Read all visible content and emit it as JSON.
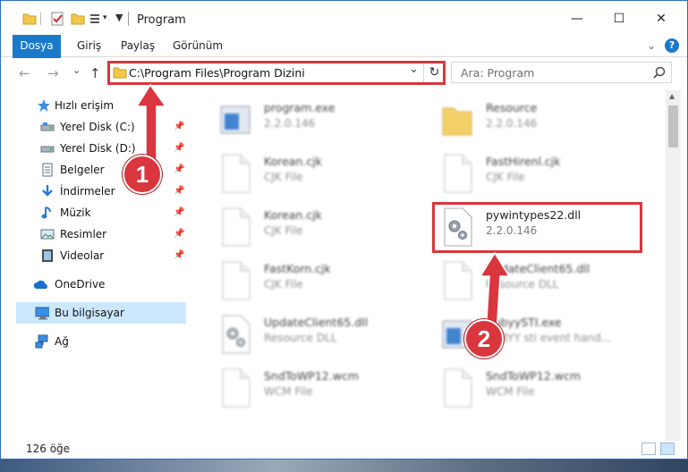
{
  "window": {
    "title": "Program",
    "controls": {
      "minimize": "—",
      "maximize": "☐",
      "close": "✕"
    }
  },
  "ribbon": {
    "tabs": [
      "Dosya",
      "Giriş",
      "Paylaş",
      "Görünüm"
    ],
    "expand": "⌄",
    "help": "?"
  },
  "nav": {
    "back": "←",
    "forward": "→",
    "recent": "⌄",
    "up": "↑",
    "address": "C:\\Program Files\\Program Dizini",
    "address_dropdown": "⌄",
    "refresh": "↻",
    "search_placeholder": "Ara: Program"
  },
  "sidebar": {
    "items": [
      {
        "label": "Hızlı erişim",
        "icon": "star-icon",
        "pinned": false
      },
      {
        "label": "Yerel Disk (C:)",
        "icon": "drive-icon",
        "pinned": true
      },
      {
        "label": "Yerel Disk (D:)",
        "icon": "drive-icon",
        "pinned": true
      },
      {
        "label": "Belgeler",
        "icon": "documents-icon",
        "pinned": true
      },
      {
        "label": "İndirmeler",
        "icon": "download-icon",
        "pinned": true
      },
      {
        "label": "Müzik",
        "icon": "music-icon",
        "pinned": true
      },
      {
        "label": "Resimler",
        "icon": "pictures-icon",
        "pinned": true
      },
      {
        "label": "Videolar",
        "icon": "videos-icon",
        "pinned": true
      },
      {
        "label": "OneDrive",
        "icon": "cloud-icon",
        "pinned": false
      },
      {
        "label": "Bu bilgisayar",
        "icon": "computer-icon",
        "pinned": false,
        "selected": true
      },
      {
        "label": "Ağ",
        "icon": "network-icon",
        "pinned": false
      }
    ],
    "pin_glyph": "📌"
  },
  "files": [
    {
      "name": "program.exe",
      "meta": "2.2.0.146",
      "icon": "exe-icon",
      "blurred": true
    },
    {
      "name": "Resource",
      "meta": "2.2.0.146",
      "icon": "folder-icon",
      "blurred": true
    },
    {
      "name": "Korean.cjk",
      "meta": "CJK File",
      "icon": "file-icon",
      "blurred": true
    },
    {
      "name": "FastHirenl.cjk",
      "meta": "CJK File",
      "icon": "file-icon",
      "blurred": true
    },
    {
      "name": "Korean.cjk",
      "meta": "CJK File",
      "icon": "file-icon",
      "blurred": true
    },
    {
      "name": "pywintypes22.dll",
      "meta": "2.2.0.146",
      "icon": "dll-gear-icon",
      "blurred": false
    },
    {
      "name": "FastKorn.cjk",
      "meta": "CJK File",
      "icon": "file-icon",
      "blurred": true
    },
    {
      "name": "UpdateClient65.dll",
      "meta": "Resource DLL",
      "icon": "file-icon",
      "blurred": true
    },
    {
      "name": "UpdateClient65.dll",
      "meta": "Resource DLL",
      "icon": "dll-gear-icon",
      "blurred": true
    },
    {
      "name": "AbbyySTI.exe",
      "meta": "ABBYY sti event hand...",
      "icon": "exe-icon",
      "blurred": true
    },
    {
      "name": "SndToWP12.wcm",
      "meta": "WCM File",
      "icon": "file-icon",
      "blurred": true
    },
    {
      "name": "SndToWP12.wcm",
      "meta": "WCM File",
      "icon": "file-icon",
      "blurred": true
    }
  ],
  "status": {
    "count": "126 öğe"
  },
  "annotations": {
    "step1": "1",
    "step2": "2",
    "color": "#d9363e"
  }
}
